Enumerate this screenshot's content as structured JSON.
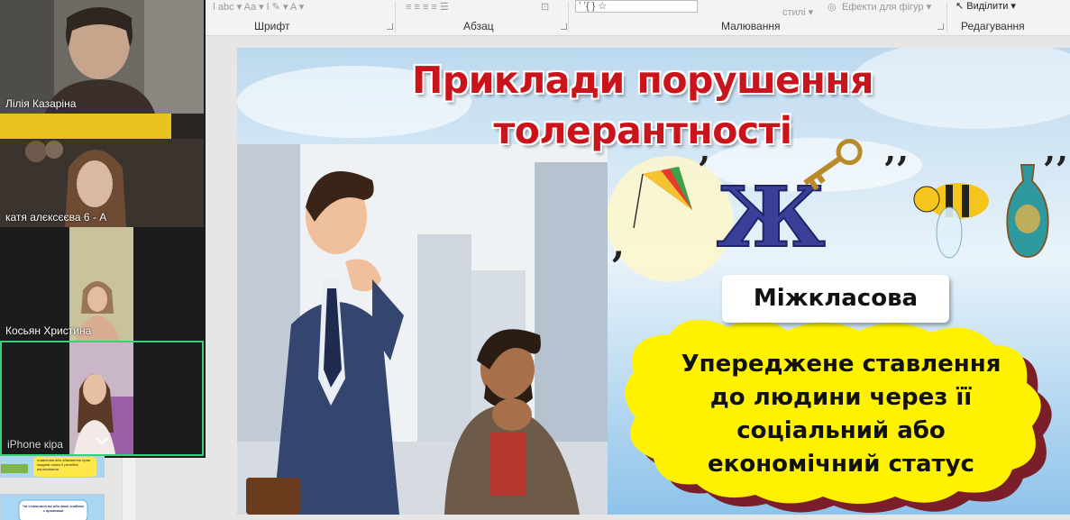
{
  "ribbon": {
    "groups": [
      "Шрифт",
      "Абзац",
      "Малювання",
      "Редагування"
    ],
    "quick_styles_label": "стилі",
    "shape_effects_label": "Ефекти для фігур",
    "select_label": "Виділити",
    "shapes_gallery_text": "ʼ ʼ{ } ☆"
  },
  "video_tiles": [
    {
      "name": "Лілія Казаріна"
    },
    {
      "name": "катя алєксєєва 6 - А"
    },
    {
      "name": "Косьян Христина"
    },
    {
      "name": "iPhone кіра"
    }
  ],
  "slide": {
    "title_line1": "Приклади порушення",
    "title_line2": "толерантності",
    "label": "Міжкласова",
    "body_lines": [
      "Упереджене ставлення",
      "до людини через її",
      "соціальний або",
      "економічний статус"
    ]
  },
  "thumbnails": [
    {
      "text": "ставлення або обмеження прав людини через її релігійні переконання"
    },
    {
      "text": "Чи стикалися ви або ваші знайомі з проявами"
    }
  ]
}
